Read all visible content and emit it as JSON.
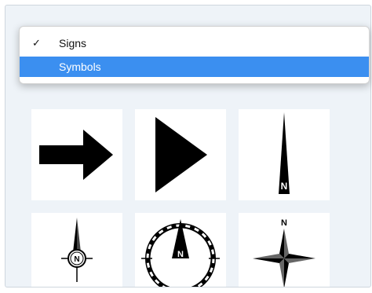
{
  "menu": {
    "items": [
      {
        "label": "Signs",
        "checked": true,
        "check_glyph": "✓"
      },
      {
        "label": "Symbols",
        "highlighted": true
      }
    ]
  },
  "symbols": {
    "tiles": [
      {
        "name": "block-right-arrow",
        "icon": "right-arrow-icon"
      },
      {
        "name": "play-triangle",
        "icon": "triangle-right-icon"
      },
      {
        "name": "north-arrow-needle",
        "icon": "north-needle-icon",
        "text": "N"
      },
      {
        "name": "north-arrow-circle",
        "icon": "north-circle-icon",
        "text": "N"
      },
      {
        "name": "compass-dial",
        "icon": "compass-dial-icon",
        "text": "N"
      },
      {
        "name": "compass-star",
        "icon": "compass-star-icon",
        "text": "N"
      }
    ]
  },
  "colors": {
    "panel_bg": "#eef3f8",
    "highlight": "#3b8ff0",
    "symbol_fill": "#000000"
  }
}
